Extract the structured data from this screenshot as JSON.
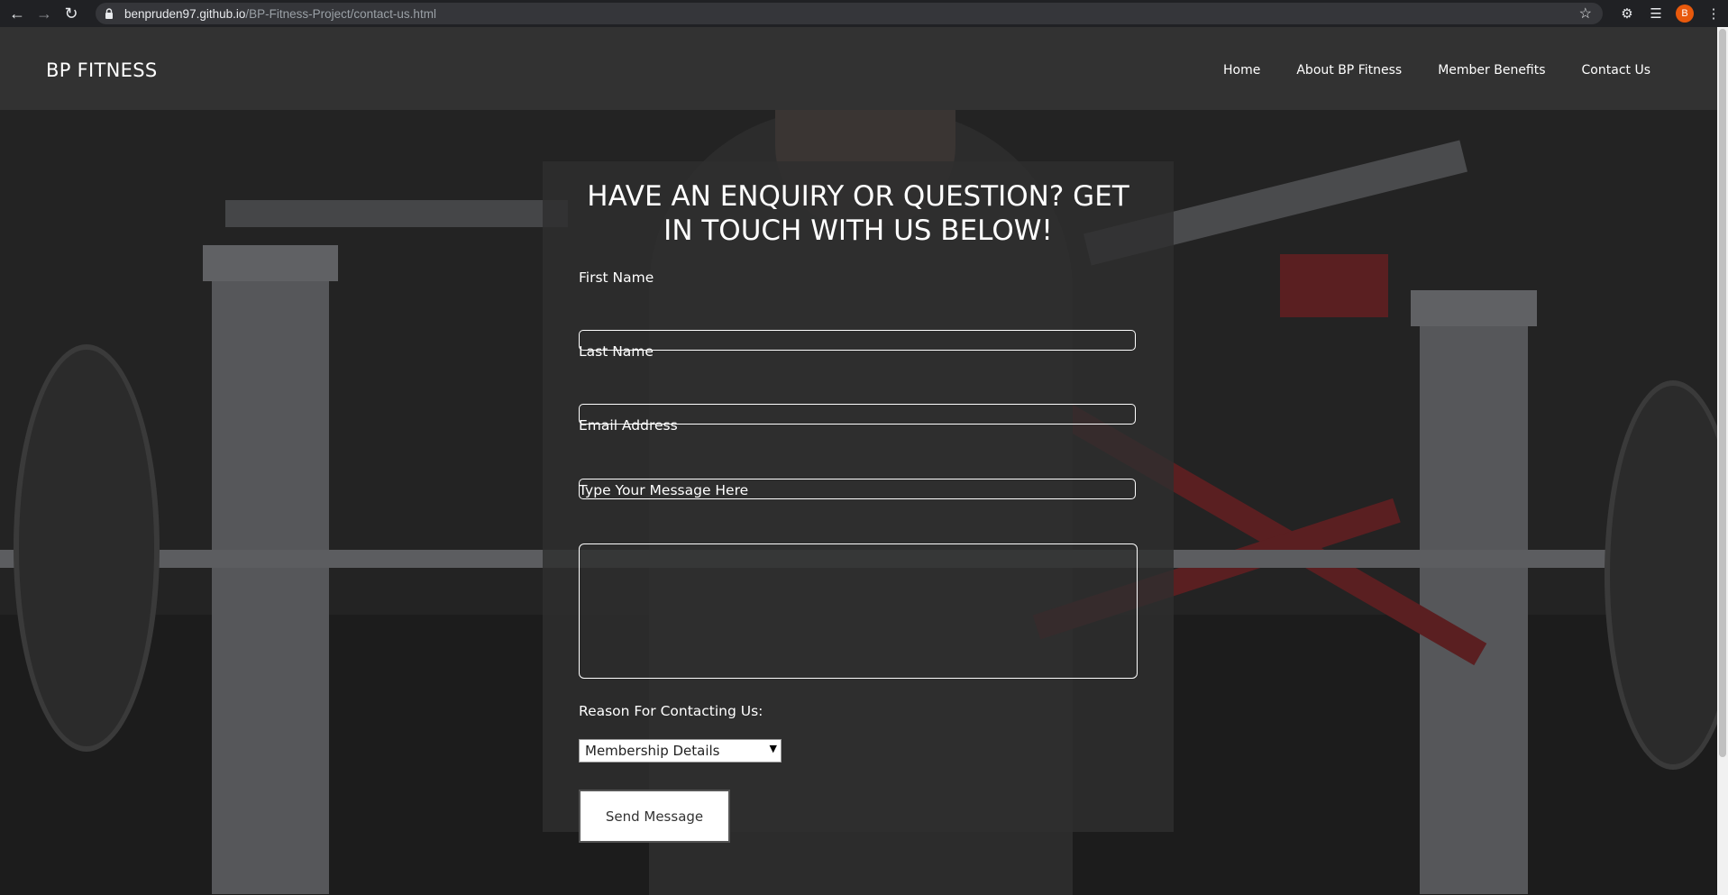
{
  "browser": {
    "url_host": "benpruden97.github.io",
    "url_path": "/BP-Fitness-Project/contact-us.html",
    "profile_initial": "B"
  },
  "site": {
    "brand": "BP FITNESS",
    "nav": [
      "Home",
      "About BP Fitness",
      "Member Benefits",
      "Contact Us"
    ]
  },
  "form": {
    "heading": "HAVE AN ENQUIRY OR QUESTION? GET IN TOUCH WITH US BELOW!",
    "first_name_label": "First Name",
    "last_name_label": "Last Name",
    "email_label": "Email Address",
    "message_label": "Type Your Message Here",
    "reason_label": "Reason For Contacting Us:",
    "reason_selected": "Membership Details",
    "submit_label": "Send Message"
  },
  "colors": {
    "header_bg": "#333333",
    "panel_bg": "#2e2e2e",
    "text": "#ffffff"
  }
}
